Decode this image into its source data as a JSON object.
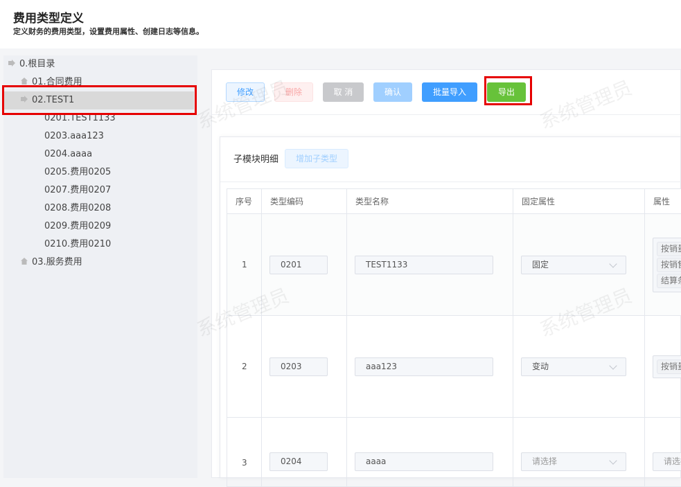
{
  "header": {
    "title": "费用类型定义",
    "subtitle": "定义财务的费用类型，设置费用属性、创建日志等信息。"
  },
  "tree": {
    "root": "0.根目录",
    "items": [
      "01.合同费用",
      "02.TEST1",
      "0201.TEST1133",
      "0203.aaa123",
      "0204.aaaa",
      "0205.费用0205",
      "0207.费用0207",
      "0208.费用0208",
      "0209.费用0209",
      "0210.费用0210",
      "03.服务费用"
    ]
  },
  "toolbar": {
    "edit": "修改",
    "delete": "删除",
    "cancel": "取 消",
    "confirm": "确认",
    "import": "批量导入",
    "export": "导出"
  },
  "submodule": {
    "label": "子模块明细",
    "add": "增加子类型"
  },
  "table": {
    "headers": [
      "序号",
      "类型编码",
      "类型名称",
      "固定属性",
      "属性"
    ],
    "rows": [
      {
        "no": "1",
        "code": "0201",
        "name": "TEST1133",
        "fixed": "固定",
        "attrs": [
          "按销量",
          "按销售",
          "结算条"
        ]
      },
      {
        "no": "2",
        "code": "0203",
        "name": "aaa123",
        "fixed": "变动",
        "attrs": [
          "按销量"
        ]
      },
      {
        "no": "3",
        "code": "0204",
        "name": "aaaa",
        "fixed": "请选择",
        "attrs_placeholder": "请选择"
      }
    ]
  },
  "watermark": "系统管理员"
}
